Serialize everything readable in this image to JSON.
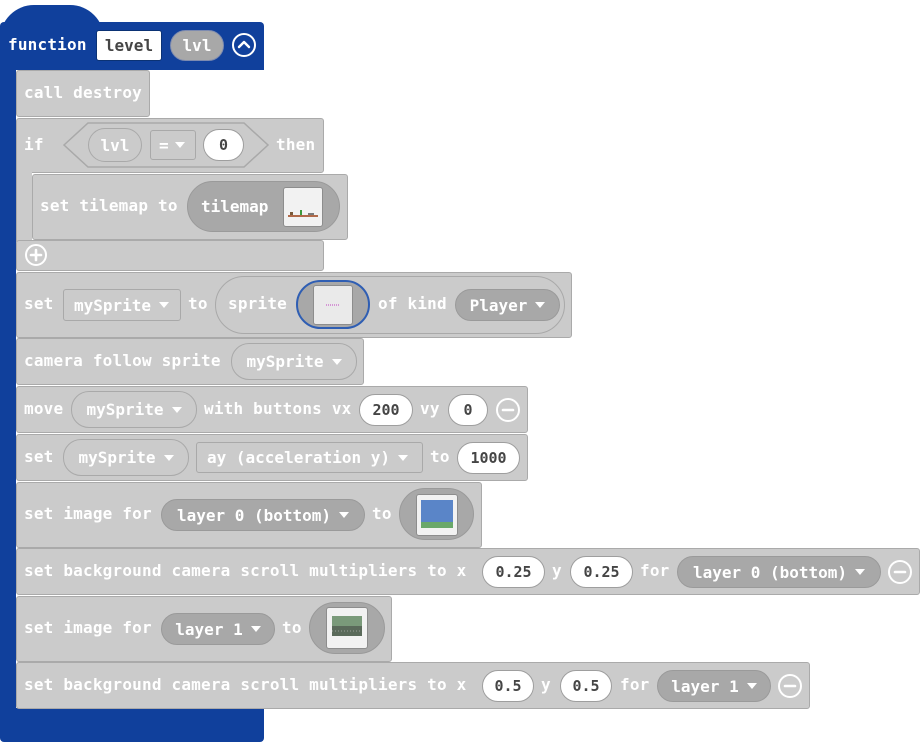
{
  "function_block": {
    "keyword": "function",
    "name": "level",
    "param": "lvl"
  },
  "blocks": {
    "call_destroy": "call destroy",
    "if_block": {
      "if_label": "if",
      "var": "lvl",
      "operator": "=",
      "value": "0",
      "then_label": "then",
      "set_tilemap_label": "set tilemap to",
      "tilemap_label": "tilemap"
    },
    "set_sprite": {
      "set_label": "set",
      "variable": "mySprite",
      "to_label": "to",
      "sprite_label": "sprite",
      "of_kind_label": "of kind",
      "kind": "Player"
    },
    "camera_follow": {
      "label": "camera follow sprite",
      "sprite": "mySprite"
    },
    "move": {
      "move_label": "move",
      "sprite": "mySprite",
      "with_buttons_label": "with buttons vx",
      "vx": "200",
      "vy_label": "vy",
      "vy": "0"
    },
    "set_accel": {
      "set_label": "set",
      "sprite": "mySprite",
      "property": "ay (acceleration y)",
      "to_label": "to",
      "value": "1000"
    },
    "set_image_0": {
      "label": "set image for",
      "layer": "layer 0 (bottom)",
      "to_label": "to"
    },
    "scroll_0": {
      "label": "set background camera scroll multipliers to x",
      "x": "0.25",
      "y_label": "y",
      "y": "0.25",
      "for_label": "for",
      "layer": "layer 0 (bottom)"
    },
    "set_image_1": {
      "label": "set image for",
      "layer": "layer 1",
      "to_label": "to"
    },
    "scroll_1": {
      "label": "set background camera scroll multipliers to x",
      "x": "0.5",
      "y_label": "y",
      "y": "0.5",
      "for_label": "for",
      "layer": "layer 1"
    }
  },
  "colors": {
    "function_block": "#10409c",
    "statement_block": "#cbcbcb",
    "reporter": "#a8a8a8"
  },
  "icons": [
    "collapse-icon",
    "add-else-icon",
    "remove-input-icon"
  ]
}
